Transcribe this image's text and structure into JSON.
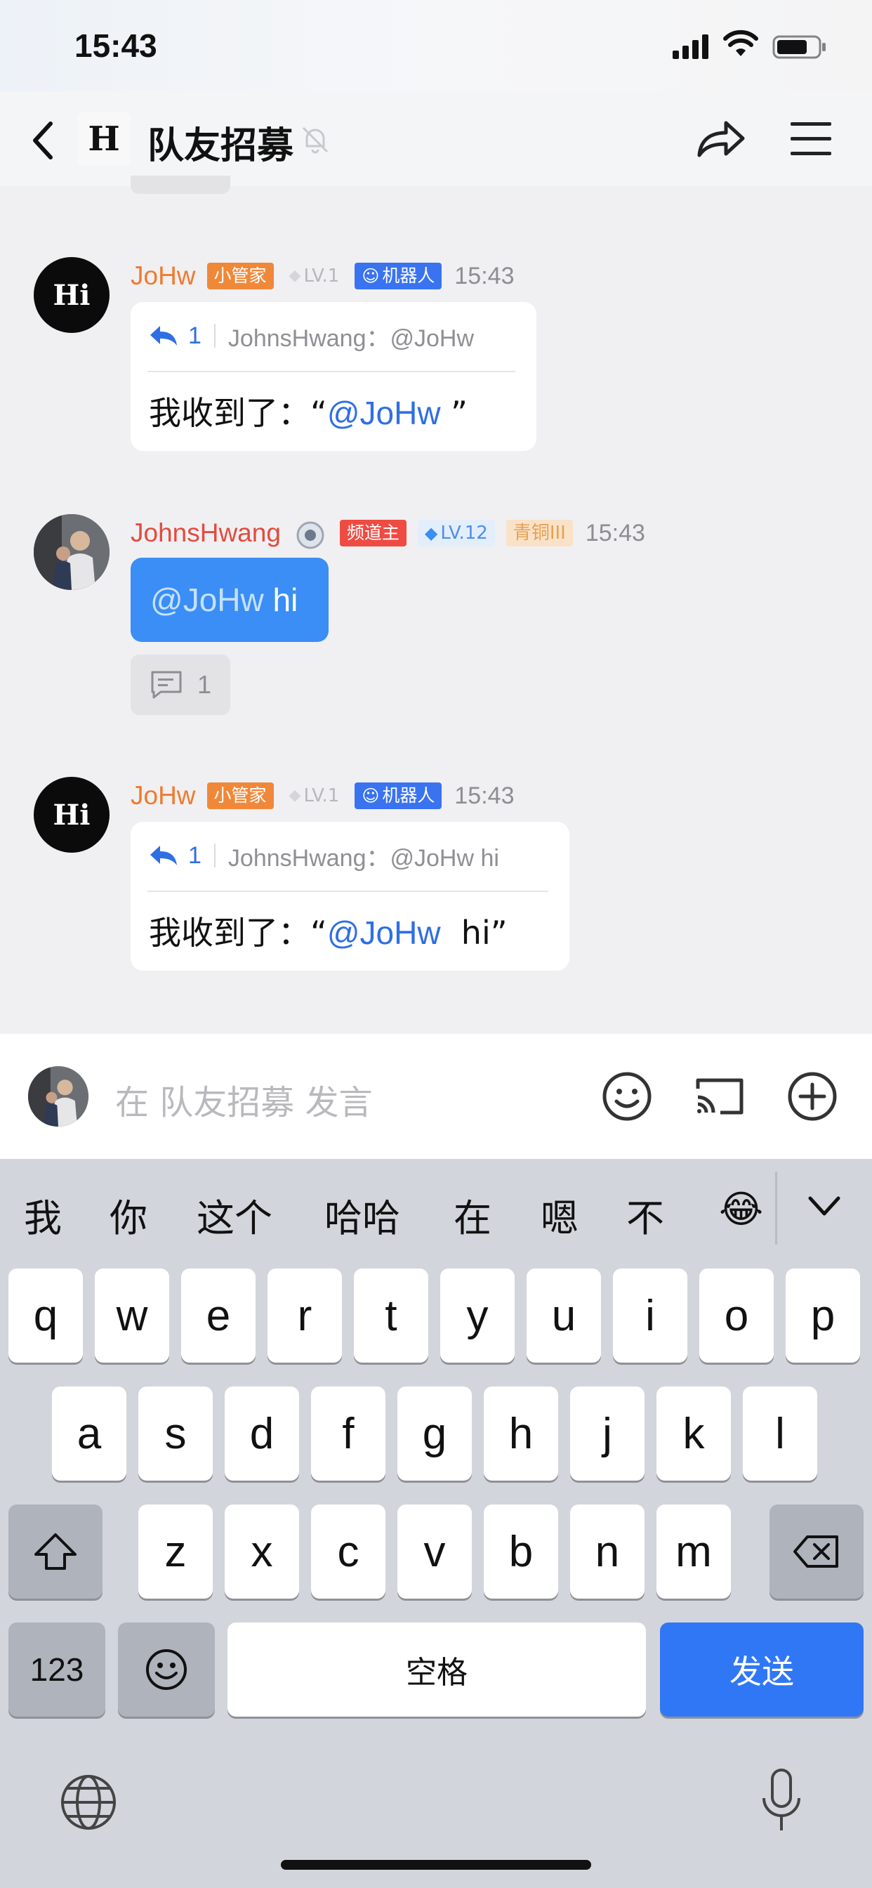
{
  "status_bar": {
    "time": "15:43"
  },
  "header": {
    "logo_text": "H",
    "title": "队友招募"
  },
  "messages": [
    {
      "avatar_text": "Hi",
      "sender": "JoHw",
      "badges": [
        "小管家",
        "LV.1",
        "机器人"
      ],
      "time": "15:43",
      "quote_count": "1",
      "quote_text": "JohnsHwang：@JoHw",
      "reply_prefix": "我收到了：“",
      "reply_mention": "@JoHw",
      "reply_suffix": " ”"
    },
    {
      "sender": "JohnsHwang",
      "badges": [
        "频道主",
        "LV.12",
        "青铜III"
      ],
      "time": "15:43",
      "mention": "@JoHw",
      "text": " hi",
      "thread_count": "1"
    },
    {
      "avatar_text": "Hi",
      "sender": "JoHw",
      "badges": [
        "小管家",
        "LV.1",
        "机器人"
      ],
      "time": "15:43",
      "quote_count": "1",
      "quote_text": "JohnsHwang：@JoHw hi",
      "reply_prefix": "我收到了：“",
      "reply_mention": "@JoHw",
      "reply_suffix": "  hi”"
    }
  ],
  "input": {
    "placeholder": "在 队友招募 发言"
  },
  "keyboard": {
    "suggestions": [
      "我",
      "你",
      "这个",
      "哈哈",
      "在",
      "嗯",
      "不",
      "😂"
    ],
    "row1": [
      "q",
      "w",
      "e",
      "r",
      "t",
      "y",
      "u",
      "i",
      "o",
      "p"
    ],
    "row2": [
      "a",
      "s",
      "d",
      "f",
      "g",
      "h",
      "j",
      "k",
      "l"
    ],
    "row3": [
      "z",
      "x",
      "c",
      "v",
      "b",
      "n",
      "m"
    ],
    "numbers_label": "123",
    "space_label": "空格",
    "send_label": "发送"
  },
  "colors": {
    "accent": "#2f77f5",
    "bubble_blue": "#3a8ef5",
    "sender_orange": "#f07a2e",
    "sender_red": "#e34b3f"
  }
}
